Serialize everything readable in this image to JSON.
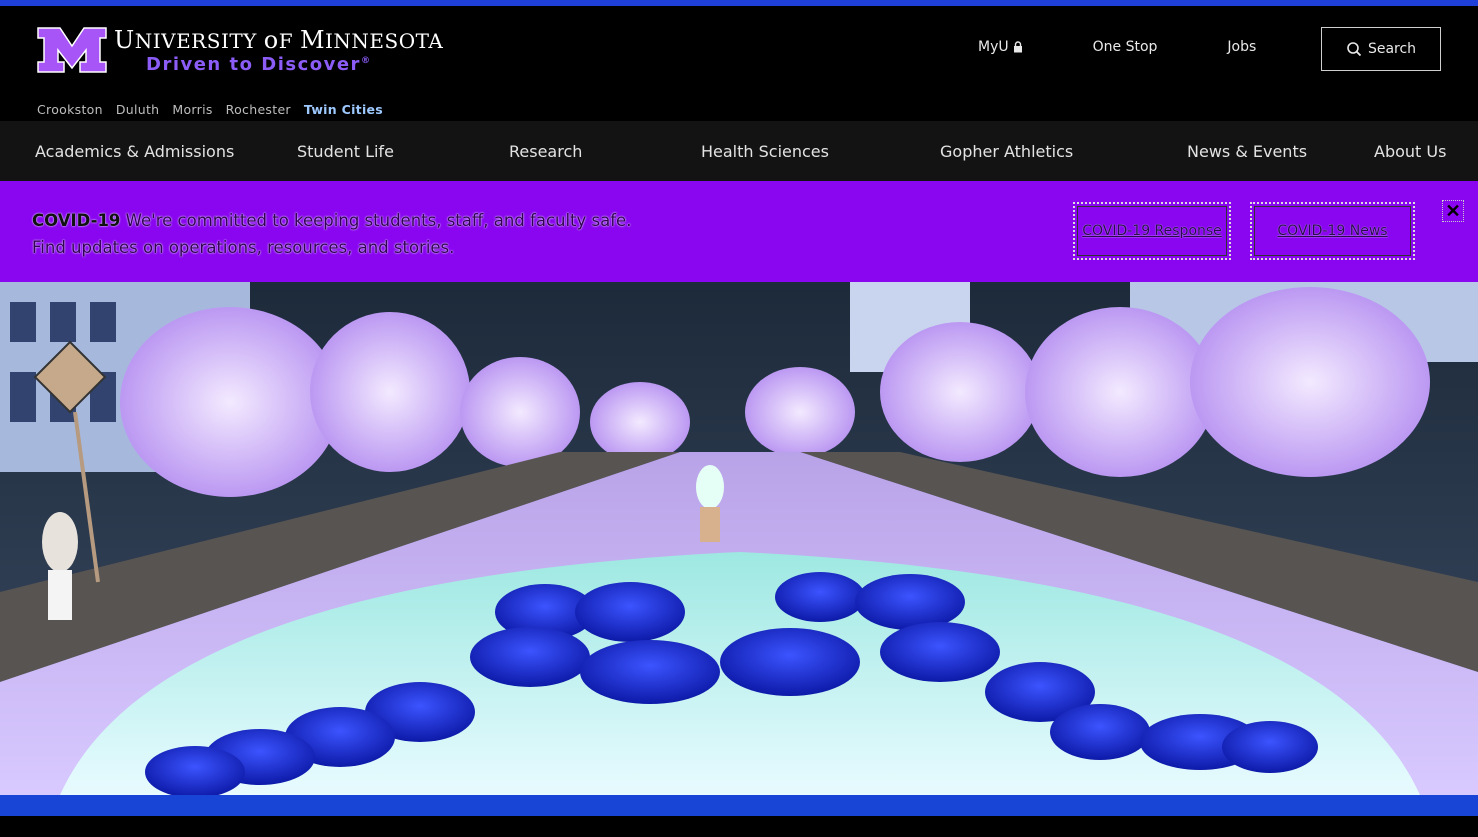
{
  "header": {
    "wordmark": "University of Minnesota",
    "tagline": "Driven to Discover",
    "tagline_mark": "®",
    "campuses": [
      "Crookston",
      "Duluth",
      "Morris",
      "Rochester",
      "Twin Cities"
    ],
    "current_campus": "Twin Cities"
  },
  "utility_nav": {
    "myu": "MyU",
    "one_stop": "One Stop",
    "jobs": "Jobs",
    "search": "Search"
  },
  "main_nav": [
    "Academics & Admissions",
    "Student Life",
    "Research",
    "Health Sciences",
    "Gopher Athletics",
    "News & Events",
    "About Us"
  ],
  "alert": {
    "label": "COVID-19",
    "message": "We're committed to keeping students, staff, and faculty safe. Find updates on operations, resources, and stories.",
    "button_response": "COVID-19 Response",
    "button_news": "COVID-19 News",
    "close": "✕"
  },
  "colors": {
    "top_stripe": "#1e40d8",
    "alert_bg": "#8a05f0",
    "nav_bg": "#131313",
    "bottom_band": "#1845d6"
  },
  "icons": [
    "block-m-logo",
    "lock-icon",
    "search-icon",
    "close-icon"
  ]
}
